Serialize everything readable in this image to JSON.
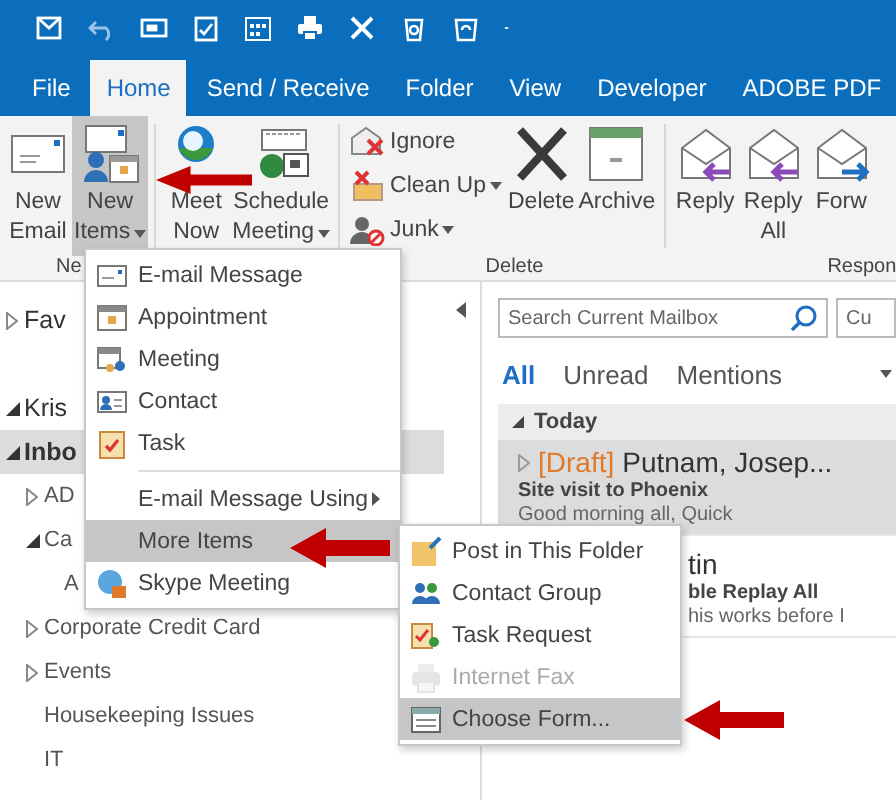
{
  "tabs": [
    {
      "label": "File",
      "selected": false
    },
    {
      "label": "Home",
      "selected": true
    },
    {
      "label": "Send / Receive",
      "selected": false
    },
    {
      "label": "Folder",
      "selected": false
    },
    {
      "label": "View",
      "selected": false
    },
    {
      "label": "Developer",
      "selected": false
    },
    {
      "label": "ADOBE PDF",
      "selected": false
    }
  ],
  "ribbon": {
    "buttons": [
      {
        "kind": "large",
        "lines": [
          "New",
          "Email"
        ],
        "dropdown": false,
        "selected": false
      },
      {
        "kind": "large",
        "lines": [
          "New",
          "Items"
        ],
        "dropdown": true,
        "selected": true
      },
      {
        "kind": "large",
        "lines": [
          "Meet",
          "Now"
        ],
        "dropdown": false,
        "selected": false
      },
      {
        "kind": "large",
        "lines": [
          "Schedule",
          "Meeting"
        ],
        "dropdown": true,
        "selected": false
      },
      {
        "kind": "small",
        "items": [
          {
            "label": "Ignore",
            "dropdown": false
          },
          {
            "label": "Clean Up",
            "dropdown": true
          },
          {
            "label": "Junk",
            "dropdown": true
          }
        ]
      },
      {
        "kind": "large",
        "lines": [
          "Delete"
        ],
        "dropdown": false,
        "selected": false
      },
      {
        "kind": "large",
        "lines": [
          "Archive"
        ],
        "dropdown": false,
        "selected": false
      },
      {
        "kind": "large",
        "lines": [
          "Reply"
        ],
        "dropdown": false,
        "selected": false
      },
      {
        "kind": "large",
        "lines": [
          "Reply",
          "All"
        ],
        "dropdown": false,
        "selected": false
      },
      {
        "kind": "large",
        "lines": [
          "Forw"
        ],
        "dropdown": false,
        "selected": false
      }
    ],
    "groups": [
      "Ne",
      "Delete",
      "Respon"
    ]
  },
  "folders": [
    {
      "label": "Fav",
      "expanded": false,
      "selected": false
    },
    {
      "label": "Kris",
      "expanded": true,
      "selected": false
    },
    {
      "label": "Inbo",
      "expanded": true,
      "selected": true,
      "children": [
        {
          "label": "AD",
          "expanded": false,
          "selected": false
        },
        {
          "label": "Ca",
          "expanded": true,
          "selected": false,
          "children": [
            {
              "label": "A",
              "selected": false
            }
          ]
        },
        {
          "label": "Corporate Credit Card",
          "expanded": false,
          "selected": false
        },
        {
          "label": "Events",
          "expanded": false,
          "selected": false
        },
        {
          "label": "Housekeeping Issues",
          "selected": false
        },
        {
          "label": "IT",
          "selected": false
        }
      ]
    }
  ],
  "search": {
    "placeholder": "Search Current Mailbox",
    "scope_placeholder": "Cu"
  },
  "filters": [
    {
      "label": "All",
      "selected": true
    },
    {
      "label": "Unread",
      "selected": false
    },
    {
      "label": "Mentions",
      "selected": false
    }
  ],
  "group_header": "Today",
  "messages": [
    {
      "selected": true,
      "tag": "[Draft]",
      "sender": "Putnam, Josep...",
      "subject": "Site visit to Phoenix",
      "preview": "Good morning all,  Quick"
    },
    {
      "selected": false,
      "sender": "tin",
      "subject": "ble Replay All",
      "preview": "his works before I"
    }
  ],
  "new_items_menu": [
    {
      "label": "E-mail Message",
      "selected": false,
      "separator_before": false,
      "submenu": false
    },
    {
      "label": "Appointment",
      "selected": false,
      "separator_before": false,
      "submenu": false
    },
    {
      "label": "Meeting",
      "selected": false,
      "separator_before": false,
      "submenu": false
    },
    {
      "label": "Contact",
      "selected": false,
      "separator_before": false,
      "submenu": false
    },
    {
      "label": "Task",
      "selected": false,
      "separator_before": false,
      "submenu": false
    },
    {
      "label": "E-mail Message Using",
      "selected": false,
      "separator_before": true,
      "submenu": true
    },
    {
      "label": "More Items",
      "selected": true,
      "separator_before": false,
      "submenu": false
    },
    {
      "label": "Skype Meeting",
      "selected": false,
      "separator_before": false,
      "submenu": false
    }
  ],
  "more_items_menu": [
    {
      "label": "Post in This Folder",
      "selected": false,
      "disabled": false
    },
    {
      "label": "Contact Group",
      "selected": false,
      "disabled": false
    },
    {
      "label": "Task Request",
      "selected": false,
      "disabled": false
    },
    {
      "label": "Internet Fax",
      "selected": false,
      "disabled": true
    },
    {
      "label": "Choose Form...",
      "selected": true,
      "disabled": false
    }
  ]
}
